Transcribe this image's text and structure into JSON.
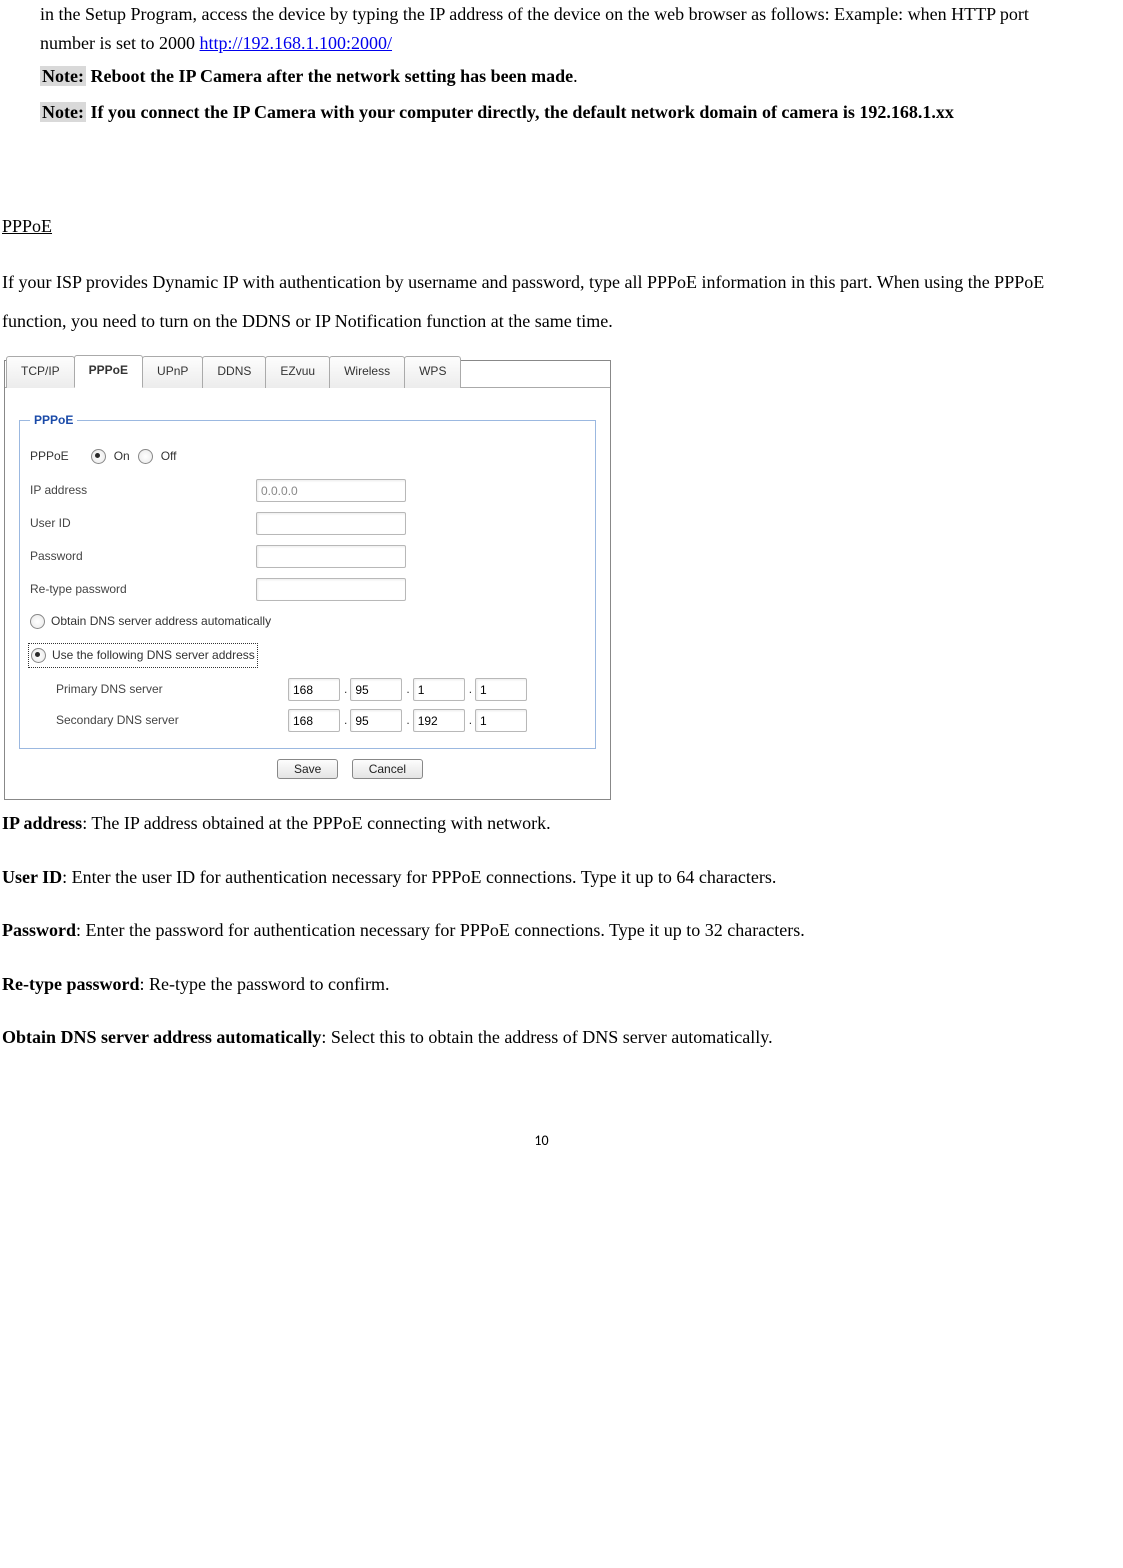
{
  "lead": {
    "line1a": "in the Setup Program, access the device by typing the IP address of the device on the web browser as follows: Example: when HTTP port number is set to 2000 ",
    "link": "http://192.168.1.100:2000/",
    "note1_prefix": "Note:",
    "note1_rest": " Reboot the IP Camera after the network setting has been made",
    "note2_prefix": "Note:",
    "note2_rest": " If you connect the IP Camera with your computer directly, the default network domain of camera is 192.168.1.xx"
  },
  "section_title": "PPPoE",
  "intro": "If your ISP provides Dynamic IP with authentication by username and password, type all PPPoE information in this part. When using the PPPoE function, you need to turn on the DDNS or IP Notification function at the same time.",
  "ui": {
    "tabs": [
      "TCP/IP",
      "PPPoE",
      "UPnP",
      "DDNS",
      "EZvuu",
      "Wireless",
      "WPS"
    ],
    "active_tab": "PPPoE",
    "legend": "PPPoE",
    "pppoe_label": "PPPoE",
    "on": "On",
    "off": "Off",
    "ip_address_label": "IP address",
    "ip_address_value": "0.0.0.0",
    "user_id_label": "User ID",
    "password_label": "Password",
    "retype_label": "Re-type password",
    "dns_auto": "Obtain DNS server address automatically",
    "dns_manual": "Use the following DNS server address",
    "primary_label": "Primary DNS server",
    "secondary_label": "Secondary DNS server",
    "primary": [
      "168",
      "95",
      "1",
      "1"
    ],
    "secondary": [
      "168",
      "95",
      "192",
      "1"
    ],
    "save": "Save",
    "cancel": "Cancel"
  },
  "defs": {
    "ip_title": "IP address",
    "ip_body": ": The IP address obtained at the PPPoE connecting with network.",
    "uid_title": "User ID",
    "uid_body": ": Enter the user ID for authentication necessary for PPPoE connections. Type it up to 64 characters.",
    "pw_title": "Password",
    "pw_body": ": Enter the password for authentication necessary for PPPoE connections. Type it up to 32 characters.",
    "rpw_title": "Re-type password",
    "rpw_body": ": Re-type the password to confirm.",
    "dns_title": "Obtain DNS server address automatically",
    "dns_body": ": Select this to obtain the address of DNS server automatically."
  },
  "page_number": "10"
}
